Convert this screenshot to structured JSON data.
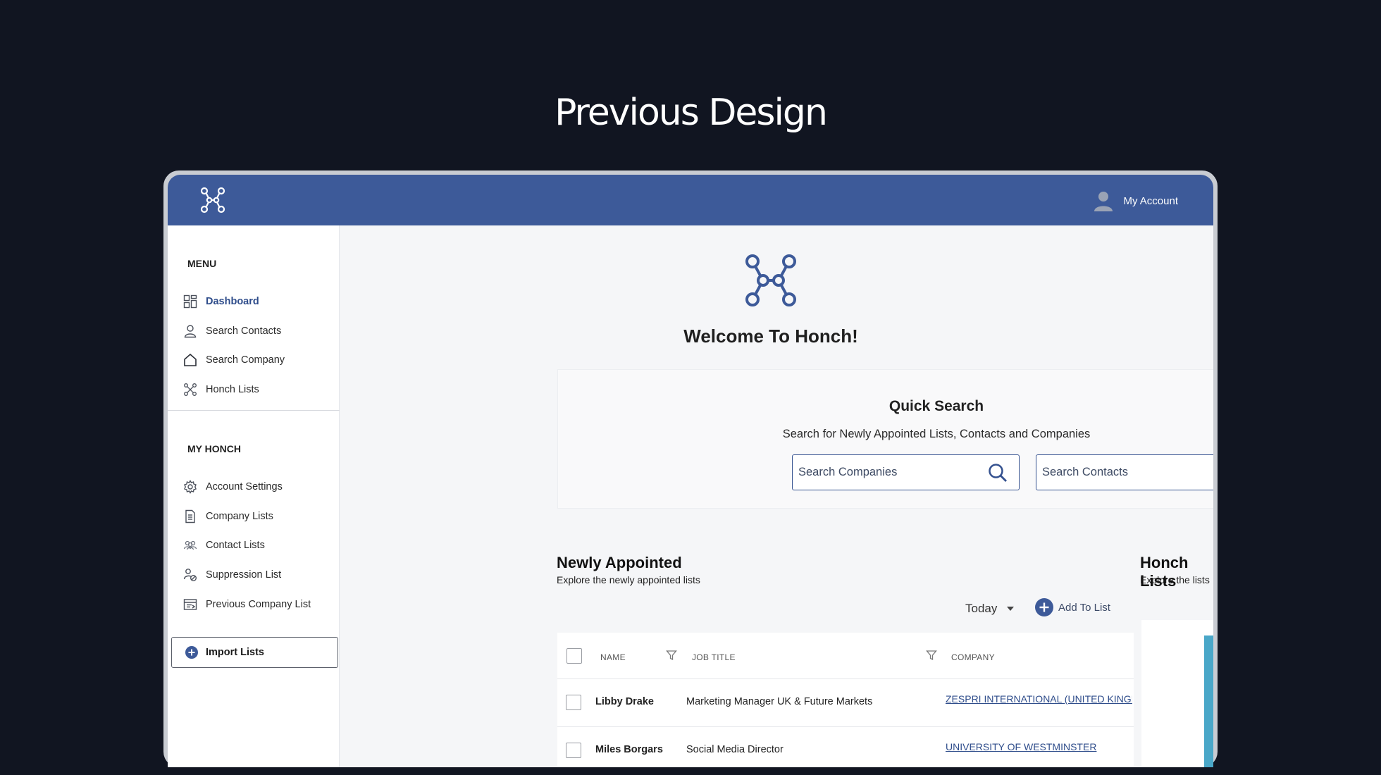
{
  "page": {
    "heading": "Previous Design"
  },
  "topbar": {
    "account_label": "My Account"
  },
  "sidebar": {
    "menu_title": "MENU",
    "menu_items": [
      {
        "label": "Dashboard",
        "icon": "dashboard-icon",
        "active": true
      },
      {
        "label": "Search Contacts",
        "icon": "user-icon"
      },
      {
        "label": "Search Company",
        "icon": "home-icon"
      },
      {
        "label": "Honch Lists",
        "icon": "honch-network-icon"
      }
    ],
    "my_honch_title": "MY HONCH",
    "my_honch_items": [
      {
        "label": "Account Settings",
        "icon": "gear-icon"
      },
      {
        "label": "Company Lists",
        "icon": "document-icon"
      },
      {
        "label": "Contact Lists",
        "icon": "group-icon"
      },
      {
        "label": "Suppression List",
        "icon": "user-block-icon"
      },
      {
        "label": "Previous Company List",
        "icon": "company-list-icon"
      }
    ],
    "import_label": "Import Lists"
  },
  "main": {
    "welcome_title": "Welcome To Honch!",
    "quick_search": {
      "title": "Quick Search",
      "subtitle": "Search for Newly Appointed Lists, Contacts and Companies",
      "companies_placeholder": "Search Companies",
      "contacts_placeholder": "Search Contacts"
    },
    "newly_appointed": {
      "title": "Newly Appointed",
      "subtitle": "Explore the newly appointed lists",
      "period": "Today",
      "add_to_list": "Add To List",
      "columns": [
        "NAME",
        "JOB TITLE",
        "COMPANY"
      ],
      "rows": [
        {
          "name": "Libby Drake",
          "job_title": "Marketing Manager UK & Future Markets",
          "company": "ZESPRI INTERNATIONAL (UNITED KINGDOM"
        },
        {
          "name": "Miles Borgars",
          "job_title": "Social Media Director",
          "company": "UNIVERSITY OF WESTMINSTER"
        }
      ]
    },
    "honch_lists": {
      "title": "Honch Lists",
      "subtitle": "Explore the lists"
    },
    "help_label": "?"
  },
  "colors": {
    "background": "#111521",
    "brand_blue": "#3d5a99",
    "tile_blue": "#4aa7c8",
    "link_blue": "#2f4d8b"
  }
}
